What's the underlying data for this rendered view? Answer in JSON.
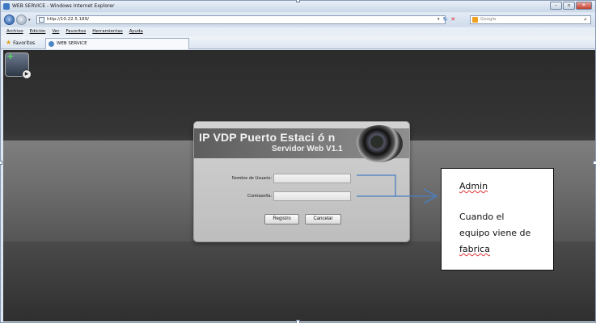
{
  "window": {
    "title": "WEB SERVICE - Windows Internet Explorer",
    "buttons": {
      "minimize": "–",
      "maximize": "▫",
      "close": "✕"
    }
  },
  "address_bar": {
    "url": "http://10.22.5.189/",
    "search_placeholder": "Google",
    "search_button": "⌕"
  },
  "menu": {
    "items": [
      "Archivo",
      "Edición",
      "Ver",
      "Favoritos",
      "Herramientas",
      "Ayuda"
    ]
  },
  "favorites_bar": {
    "favorites_label": "Favoritos",
    "tab_label": "WEB SERVICE"
  },
  "login": {
    "title": "IP VDP Puerto Estaci ó n",
    "subtitle": "Servidor Web V1.1",
    "username_label": "Nombre de Usuario:",
    "password_label": "Contraseña:",
    "login_button": "Registro",
    "cancel_button": "Cancelar"
  },
  "note": {
    "line1": "Admin",
    "line2": "Cuando el",
    "line3a": "equipo viene de",
    "line4": "fabrica"
  },
  "colors": {
    "arrow": "#4a7ec4",
    "page_background": "#3d3d3d",
    "window_frame": "#dde6f1"
  }
}
